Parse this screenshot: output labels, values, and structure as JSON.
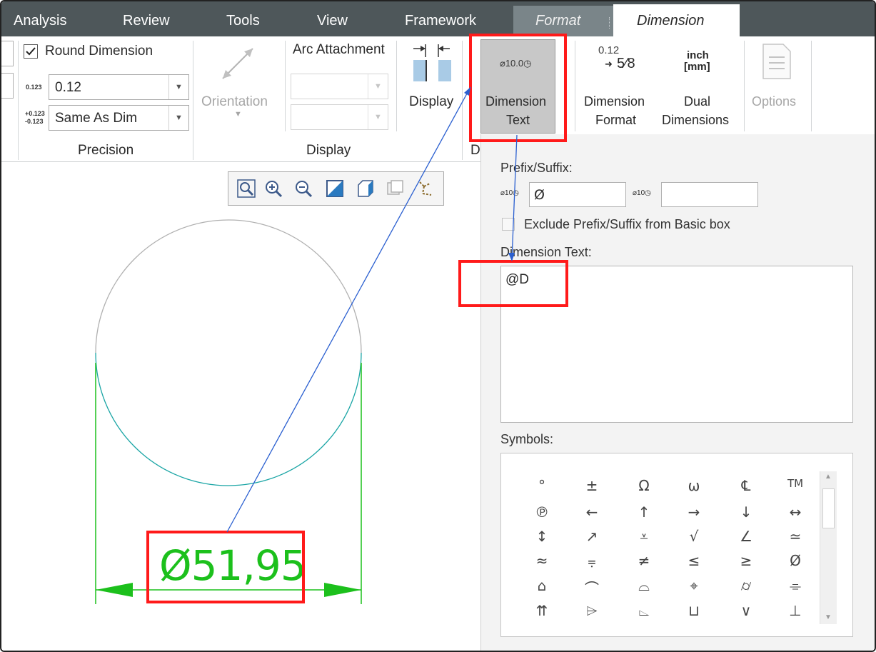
{
  "menu": {
    "items": [
      "Analysis",
      "Review",
      "Tools",
      "View",
      "Framework"
    ],
    "format_tab": "Format",
    "dimension_tab": "Dimension"
  },
  "ribbon": {
    "round_dimension_label": "Round Dimension",
    "round_dimension_checked": true,
    "precision_icon": "0.123",
    "precision_value": "0.12",
    "tolerance_icon_top": "+0.123",
    "tolerance_icon_bottom": "-0.123",
    "tolerance_value": "Same As Dim",
    "precision_group": "Precision",
    "orientation_label": "Orientation",
    "arc_attachment_label": "Arc Attachment",
    "display_group": "Display",
    "display_button": "Display",
    "d_group_cut": "D",
    "dimension_text_icon": "⌀10.0◷",
    "dimension_text_line1": "Dimension",
    "dimension_text_line2": "Text",
    "dimension_format_icon_top": "0.12",
    "dimension_format_icon_bottom": "5⁄8",
    "dimension_format_line1": "Dimension",
    "dimension_format_line2": "Format",
    "dual_icon_top": "inch",
    "dual_icon_bottom": "[mm]",
    "dual_line1": "Dual",
    "dual_line2": "Dimensions",
    "options_label": "Options"
  },
  "drawing": {
    "dimension_value": "Ø51,95"
  },
  "panel": {
    "prefix_suffix_label": "Prefix/Suffix:",
    "prefix_icon": "⌀10◷",
    "prefix_value": "Ø",
    "suffix_icon": "⌀10◷",
    "suffix_value": "",
    "exclude_label": "Exclude Prefix/Suffix from Basic box",
    "exclude_checked": false,
    "dimension_text_label": "Dimension Text:",
    "dimension_text_value": "@D",
    "symbols_label": "Symbols:"
  },
  "symbols": [
    [
      "°",
      "±",
      "Ω",
      "ω",
      "℄",
      "TM"
    ],
    [
      "℗",
      "←",
      "↑",
      "→",
      "↓",
      "↔"
    ],
    [
      "↕",
      "↗",
      "⩡",
      "√",
      "∠",
      "≃"
    ],
    [
      "≈",
      "⩦",
      "≠",
      "≤",
      "≥",
      "Ø"
    ],
    [
      "⌂",
      "⌒",
      "⌓",
      "⌖",
      "⌭",
      "⌯"
    ],
    [
      "⇈",
      "⌲",
      "⌳",
      "⊔",
      "∨",
      "⊥"
    ]
  ],
  "colors": {
    "menubar": "#4e575a",
    "highlight": "#ff1a1a",
    "dimension_green": "#1cc01c",
    "arc_teal": "#1aa5a5",
    "leader_blue": "#2a5fd0"
  }
}
